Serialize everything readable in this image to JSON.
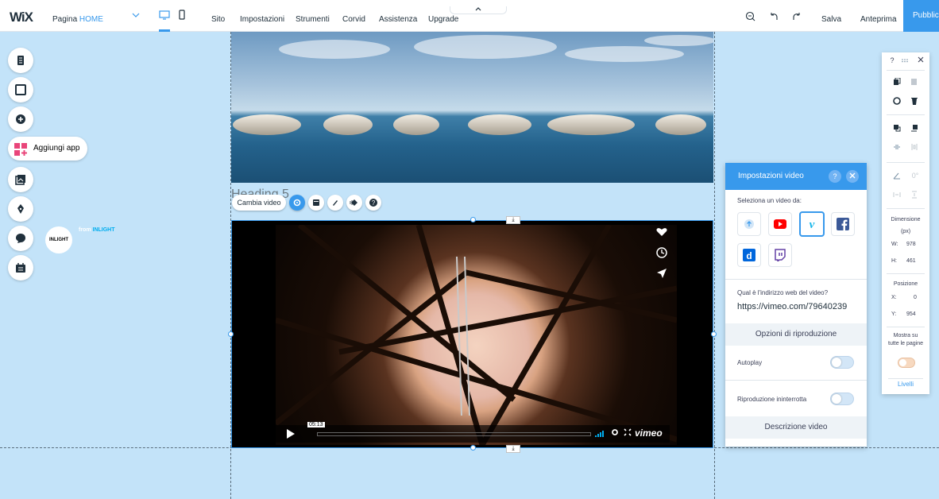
{
  "topbar": {
    "logo": "WiX",
    "page_prefix": "Pagina ",
    "page_name": "HOME",
    "menu": [
      "Sito",
      "Impostazioni",
      "Strumenti",
      "Corvid",
      "Assistenza",
      "Upgrade"
    ],
    "save": "Salva",
    "preview": "Anteprima",
    "publish": "Pubblica"
  },
  "sidebar": {
    "add_app": "Aggiungi app"
  },
  "canvas": {
    "heading": "Heading 5",
    "change_video": "Cambia video"
  },
  "video": {
    "channel_from": "from ",
    "channel_name": "INLIGHT",
    "logo_text": "INLIGHT",
    "timestamp": "05:13",
    "vimeo_brand": "vimeo"
  },
  "video_panel": {
    "title": "Impostazioni video",
    "help": "?",
    "select_label": "Seleziona un video da:",
    "url_question": "Qual è l'indirizzo web del video?",
    "url": "https://vimeo.com/79640239",
    "playback_options": "Opzioni di riproduzione",
    "autoplay": "Autoplay",
    "loop": "Riproduzione ininterrotta",
    "description": "Descrizione video"
  },
  "right_panel": {
    "help": "?",
    "dimension_label": "Dimensione",
    "unit": "(px)",
    "w_label": "W:",
    "w_value": "978",
    "h_label": "H:",
    "h_value": "461",
    "position_label": "Posizione",
    "x_label": "X:",
    "x_value": "0",
    "y_label": "Y:",
    "y_value": "954",
    "angle": "0°",
    "show_all_pages": "Mostra su tutte le pagine",
    "layers": "Livelli"
  },
  "colors": {
    "accent": "#3899ec",
    "canvas": "#c3e3f9",
    "youtube": "#ff0000",
    "vimeo": "#1ab7ea",
    "facebook": "#3b5998",
    "dailymotion": "#0066dc",
    "twitch": "#6441a5"
  }
}
